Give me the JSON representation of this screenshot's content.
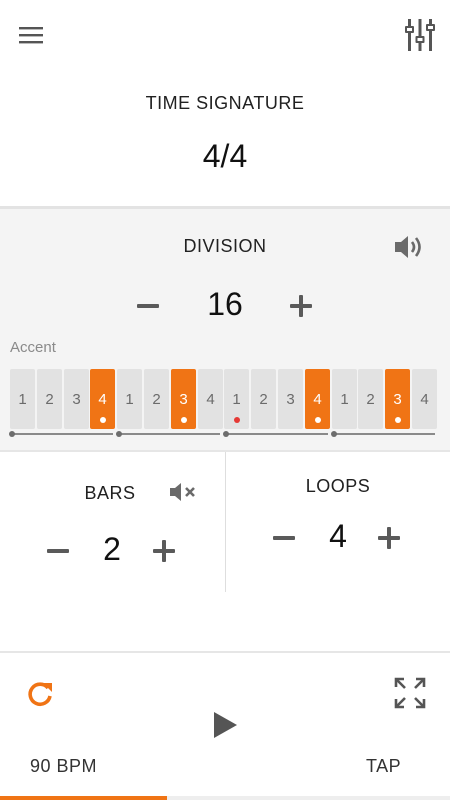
{
  "header": {
    "menu_icon": "hamburger-menu-icon",
    "mixer_icon": "equalizer-sliders-icon"
  },
  "time_signature": {
    "title": "TIME SIGNATURE",
    "value": "4/4"
  },
  "division": {
    "title": "DIVISION",
    "value": "16",
    "sound_icon": "speaker-volume-icon",
    "accent_label": "Accent",
    "beats": [
      {
        "label": "1",
        "accent": false,
        "marker": ""
      },
      {
        "label": "2",
        "accent": false,
        "marker": ""
      },
      {
        "label": "3",
        "accent": false,
        "marker": ""
      },
      {
        "label": "4",
        "accent": true,
        "marker": "dot"
      },
      {
        "label": "1",
        "accent": false,
        "marker": ""
      },
      {
        "label": "2",
        "accent": false,
        "marker": ""
      },
      {
        "label": "3",
        "accent": true,
        "marker": "dot"
      },
      {
        "label": "4",
        "accent": false,
        "marker": ""
      },
      {
        "label": "1",
        "accent": false,
        "marker": "red-dot"
      },
      {
        "label": "2",
        "accent": false,
        "marker": ""
      },
      {
        "label": "3",
        "accent": false,
        "marker": ""
      },
      {
        "label": "4",
        "accent": true,
        "marker": "dot"
      },
      {
        "label": "1",
        "accent": false,
        "marker": ""
      },
      {
        "label": "2",
        "accent": false,
        "marker": ""
      },
      {
        "label": "3",
        "accent": true,
        "marker": "dot"
      },
      {
        "label": "4",
        "accent": false,
        "marker": ""
      }
    ]
  },
  "bars": {
    "title": "BARS",
    "value": "2",
    "mute_icon": "speaker-muted-icon"
  },
  "loops": {
    "title": "LOOPS",
    "value": "4"
  },
  "transport": {
    "repeat_icon": "repeat-icon",
    "fullscreen_icon": "fullscreen-expand-icon",
    "play_icon": "play-icon",
    "bpm_label": "90 BPM",
    "tap_label": "TAP",
    "progress": 0.37
  },
  "colors": {
    "accent": "#f07415",
    "beat_off": "#e2e2e2",
    "panel_bg": "#f4f4f4",
    "current_marker": "#e53935"
  }
}
